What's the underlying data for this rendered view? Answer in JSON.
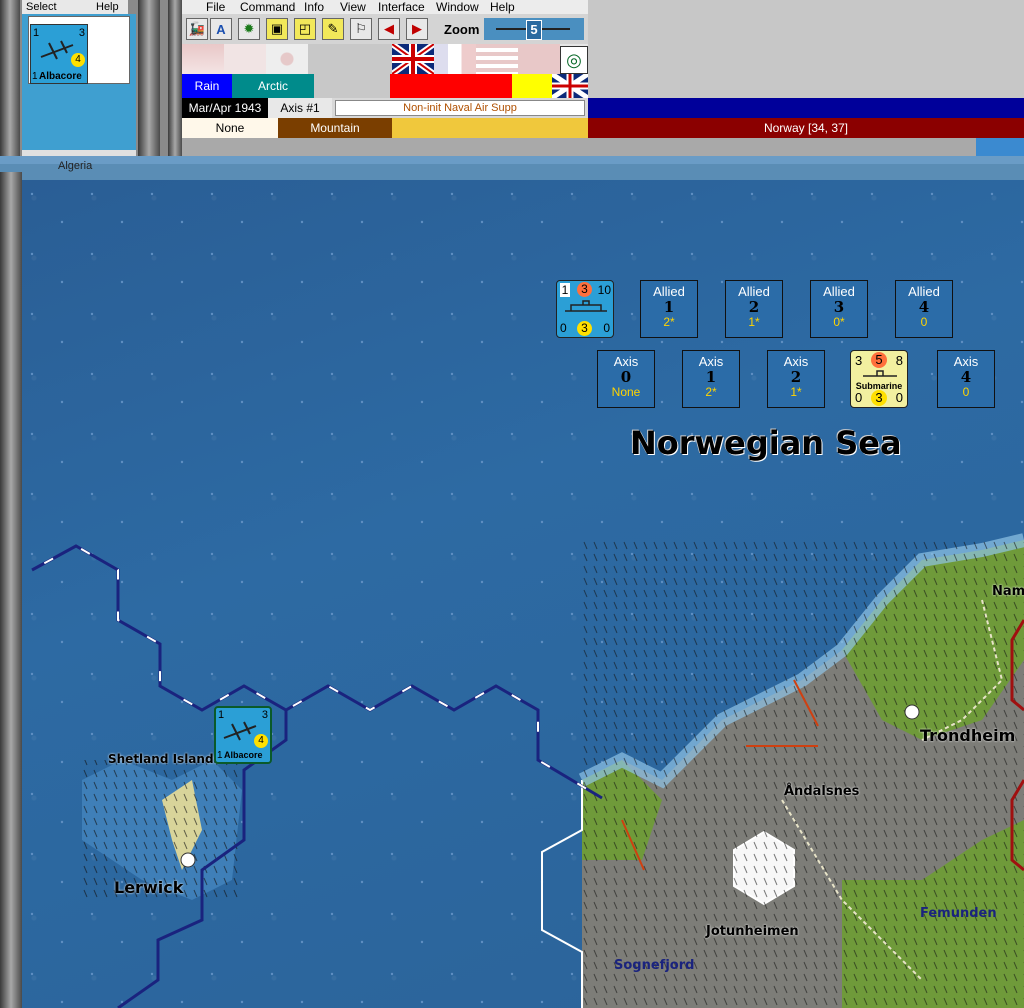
{
  "palette": {
    "select_label": "Select",
    "help_label": "Help",
    "unit": {
      "top_left": "1",
      "top_right": "3",
      "bottom_left": "1",
      "circle": "4",
      "name": "Albacore"
    }
  },
  "menu": [
    "File",
    "Command",
    "Info",
    "View",
    "Interface",
    "Window",
    "Help"
  ],
  "toolbar": {
    "zoom_label": "Zoom",
    "zoom_value": "5",
    "zoom_fraction": 0.5
  },
  "row3": {
    "weather": "Rain",
    "zone": "Arctic"
  },
  "status": {
    "date": "Mar/Apr 1943",
    "side_impulse": "Axis #1",
    "phase": "Non-init Naval Air Supp"
  },
  "terrain": {
    "left": "None",
    "type": "Mountain",
    "location": "Norway [34, 37]"
  },
  "behind_label": "Algeria",
  "map": {
    "sea_name": "Norwegian Sea",
    "allied_boxes": [
      {
        "side": "Allied",
        "num": "1",
        "val": "2*"
      },
      {
        "side": "Allied",
        "num": "2",
        "val": "1*"
      },
      {
        "side": "Allied",
        "num": "3",
        "val": "0*"
      },
      {
        "side": "Allied",
        "num": "4",
        "val": "0"
      }
    ],
    "axis_boxes": [
      {
        "side": "Axis",
        "num": "0",
        "val": "None"
      },
      {
        "side": "Axis",
        "num": "1",
        "val": "2*"
      },
      {
        "side": "Axis",
        "num": "2",
        "val": "1*"
      },
      {
        "side": "Axis",
        "num": "4",
        "val": "0"
      }
    ],
    "ship": {
      "tl": "1",
      "tc": "3",
      "tr": "10",
      "bl": "0",
      "bc": "3",
      "br": "0"
    },
    "submarine": {
      "tl": "3",
      "tc": "5",
      "tr": "8",
      "name": "Submarine",
      "bl": "0",
      "bc": "3",
      "br": "0"
    },
    "albacore": {
      "tl": "1",
      "tr": "3",
      "bl": "1",
      "circle": "4",
      "name": "Albacore"
    },
    "places": {
      "shetland": "Shetland Islands",
      "lerwick": "Lerwick",
      "trondheim": "Trondheim",
      "andalsnes": "Åndalsnes",
      "jotunheimen": "Jotunheimen",
      "sognefjord": "Sognefjord",
      "femunden": "Femunden",
      "namsos": "Nam"
    }
  },
  "colors": {
    "sea": "#2b6399",
    "rain": "#0000ff",
    "arctic": "#008b8b",
    "mountain": "#7a3e00",
    "norway": "#8b0000"
  }
}
